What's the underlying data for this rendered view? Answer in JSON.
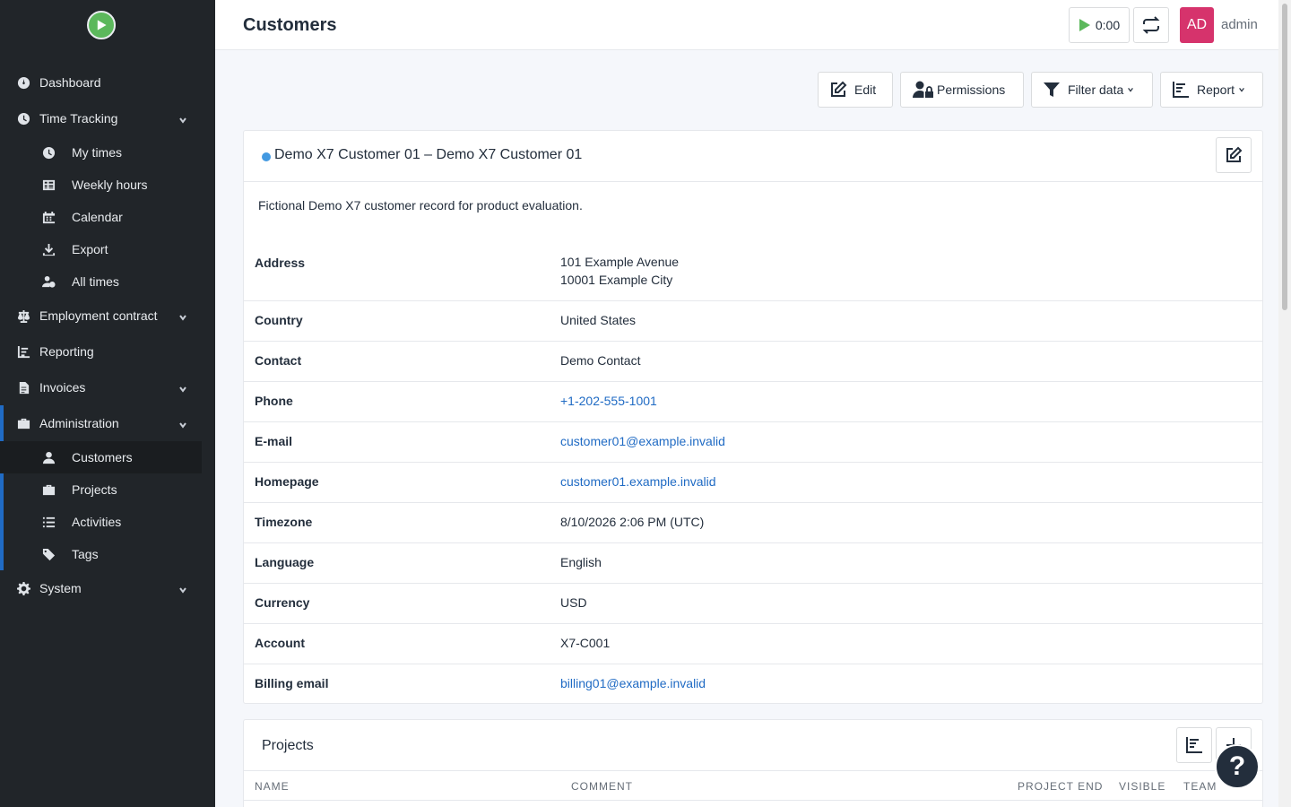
{
  "sidebar": {
    "items": [
      {
        "label": "Dashboard",
        "icon": "dashboard-icon"
      },
      {
        "label": "Time Tracking",
        "icon": "clock-icon"
      },
      {
        "label": "My times",
        "icon": "clock-icon"
      },
      {
        "label": "Weekly hours",
        "icon": "table-icon"
      },
      {
        "label": "Calendar",
        "icon": "calendar-icon"
      },
      {
        "label": "Export",
        "icon": "download-icon"
      },
      {
        "label": "All times",
        "icon": "user-clock-icon"
      },
      {
        "label": "Employment contract",
        "icon": "scale-icon"
      },
      {
        "label": "Reporting",
        "icon": "chart-icon"
      },
      {
        "label": "Invoices",
        "icon": "invoice-icon"
      },
      {
        "label": "Administration",
        "icon": "toolbox-icon"
      },
      {
        "label": "Customers",
        "icon": "user-icon"
      },
      {
        "label": "Projects",
        "icon": "briefcase-icon"
      },
      {
        "label": "Activities",
        "icon": "list-icon"
      },
      {
        "label": "Tags",
        "icon": "tags-icon"
      },
      {
        "label": "System",
        "icon": "gear-icon"
      }
    ]
  },
  "header": {
    "title": "Customers",
    "timer": "0:00",
    "avatar_initials": "AD",
    "username": "admin"
  },
  "toolbar": {
    "edit": "Edit",
    "permissions": "Permissions",
    "filter": "Filter data",
    "report": "Report"
  },
  "customer": {
    "title": "Demo X7 Customer 01  – Demo X7 Customer 01",
    "description": "Fictional Demo X7 customer record for product evaluation.",
    "fields": [
      {
        "label": "Address",
        "value": "101 Example Avenue",
        "value2": "10001 Example City"
      },
      {
        "label": "Country",
        "value": "United States"
      },
      {
        "label": "Contact",
        "value": "Demo Contact"
      },
      {
        "label": "Phone",
        "value": "+1-202-555-1001"
      },
      {
        "label": "E-mail",
        "value": "customer01@example.invalid"
      },
      {
        "label": "Homepage",
        "value": "customer01.example.invalid"
      },
      {
        "label": "Timezone",
        "value": "8/10/2026 2:06 PM (UTC)"
      },
      {
        "label": "Language",
        "value": "English"
      },
      {
        "label": "Currency",
        "value": "USD"
      },
      {
        "label": "Account",
        "value": "X7-C001"
      },
      {
        "label": "Billing email",
        "value": "billing01@example.invalid"
      }
    ]
  },
  "projects": {
    "title": "Projects",
    "columns": [
      "NAME",
      "COMMENT",
      "PROJECT END",
      "VISIBLE",
      "TEAM"
    ]
  },
  "colors": {
    "sidebar_bg": "#212529",
    "accent": "#206bc4",
    "avatar": "#d6336c",
    "status_dot": "#4299e1"
  }
}
